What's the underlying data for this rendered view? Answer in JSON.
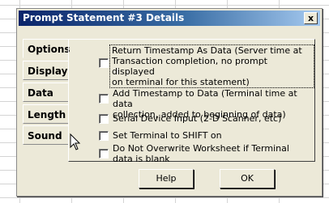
{
  "dialog": {
    "title": "Prompt Statement #3 Details",
    "close_label": "x"
  },
  "tabs": [
    {
      "label": "Options",
      "active": true
    },
    {
      "label": "Display"
    },
    {
      "label": "Data ID"
    },
    {
      "label": "Length"
    },
    {
      "label": "Sound"
    }
  ],
  "options": [
    {
      "line1": "Return Timestamp As Data  (Server time at",
      "line2": "Transaction completion, no prompt displayed",
      "line3": "on terminal for this statement)",
      "checked": false
    },
    {
      "line1": "Add Timestamp to Data (Terminal time at data",
      "line2": "collection, added to beginning of data)",
      "checked": false
    },
    {
      "line1": "Serial Device Input (2-D Scanner, etc)",
      "checked": false
    },
    {
      "line1": "Set Terminal to SHIFT on",
      "checked": false
    },
    {
      "line1": "Do Not Overwrite Worksheet if Terminal",
      "line2": "data is blank",
      "checked": false
    }
  ],
  "buttons": {
    "help": "Help",
    "ok": "OK"
  }
}
